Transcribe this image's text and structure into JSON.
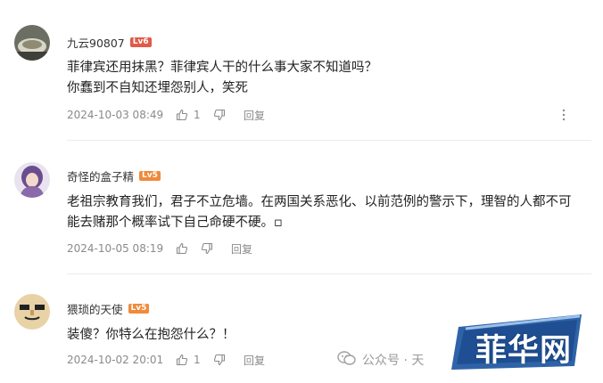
{
  "comments": [
    {
      "username": "九云90807",
      "level": "Lv6",
      "level_color": "#e05a4a",
      "lines": [
        "菲律宾还用抹黑？菲律宾人干的什么事大家不知道吗？",
        "你蠢到不自知还埋怨别人，笑死"
      ],
      "time": "2024-10-03 08:49",
      "likes": "1",
      "reply_label": "回复",
      "has_more": true
    },
    {
      "username": "奇怪的盒子精",
      "level": "Lv5",
      "level_color": "#f08a3a",
      "lines": [
        "老祖宗教育我们，君子不立危墙。在两国关系恶化、以前范例的警示下，理智的人都不可",
        "能去赌那个概率试下自己命硬不硬。▫"
      ],
      "time": "2024-10-05 08:19",
      "likes": "",
      "reply_label": "回复",
      "has_more": false
    },
    {
      "username": "猥琐的天使",
      "level": "Lv5",
      "level_color": "#f08a3a",
      "lines": [
        "装傻？你特么在抱怨什么？！"
      ],
      "time": "2024-10-02 20:01",
      "likes": "1",
      "reply_label": "回复",
      "has_more": false
    }
  ],
  "watermark": {
    "text": "公众号 · 天",
    "icon": "wechat-icon"
  },
  "brand": {
    "text": "菲华网",
    "color": "#0a2f6b"
  },
  "icons": {
    "like": "thumbs-up-icon",
    "dislike": "thumbs-down-icon",
    "more": "more-vertical-icon"
  }
}
